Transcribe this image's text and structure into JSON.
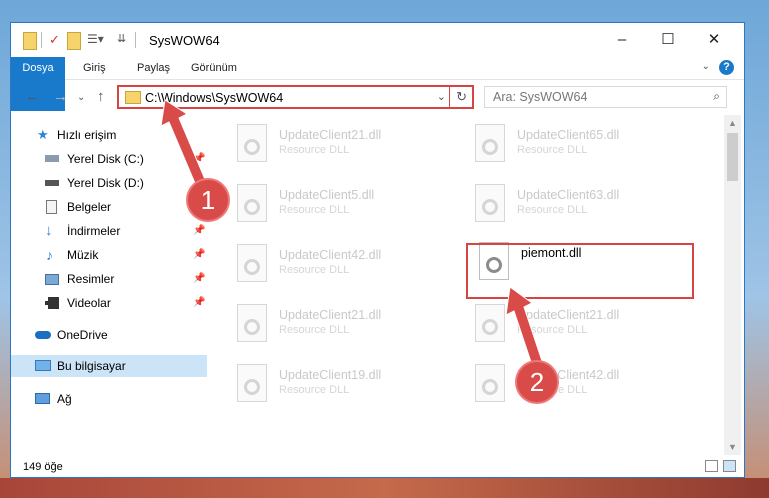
{
  "window": {
    "title": "SysWOW64"
  },
  "ribbon": {
    "tabs": [
      "Dosya",
      "Giriş",
      "Paylaş",
      "Görünüm"
    ],
    "help": "?"
  },
  "address": {
    "path": "C:\\Windows\\SysWOW64"
  },
  "search": {
    "placeholder": "Ara: SysWOW64"
  },
  "sidebar": {
    "items": [
      {
        "label": "Hızlı erişim",
        "icon": "star-icon"
      },
      {
        "label": "Yerel Disk (C:)",
        "icon": "drive-icon"
      },
      {
        "label": "Yerel Disk (D:)",
        "icon": "drive-icon"
      },
      {
        "label": "Belgeler",
        "icon": "documents-icon"
      },
      {
        "label": "İndirmeler",
        "icon": "download-icon"
      },
      {
        "label": "Müzik",
        "icon": "music-icon"
      },
      {
        "label": "Resimler",
        "icon": "pictures-icon"
      },
      {
        "label": "Videolar",
        "icon": "videos-icon"
      },
      {
        "label": "OneDrive",
        "icon": "cloud-icon"
      },
      {
        "label": "Bu bilgisayar",
        "icon": "computer-icon"
      },
      {
        "label": "Ağ",
        "icon": "network-icon"
      }
    ]
  },
  "files": [
    {
      "name": "UpdateClient21.dll",
      "type": "Resource DLL"
    },
    {
      "name": "UpdateClient65.dll",
      "type": "Resource DLL"
    },
    {
      "name": "UpdateClient5.dll",
      "type": "Resource DLL"
    },
    {
      "name": "UpdateClient63.dll",
      "type": "Resource DLL"
    },
    {
      "name": "UpdateClient42.dll",
      "type": "Resource DLL"
    },
    {
      "name": "piemont.dll",
      "type": ""
    },
    {
      "name": "UpdateClient21.dll",
      "type": "Resource DLL"
    },
    {
      "name": "UpdateClient21.dll",
      "type": "Resource DLL"
    },
    {
      "name": "UpdateClient19.dll",
      "type": "Resource DLL"
    },
    {
      "name": "UpdateClient42.dll",
      "type": "Resource DLL"
    }
  ],
  "status": {
    "count": "149 öğe"
  },
  "steps": [
    "1",
    "2"
  ],
  "colors": {
    "accent": "#1979ca",
    "highlight": "#d64541"
  }
}
